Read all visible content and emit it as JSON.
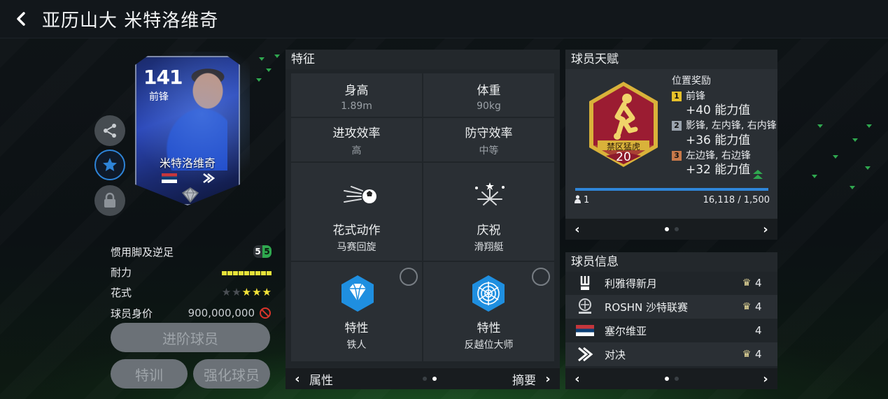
{
  "header": {
    "title": "亚历山大 米特洛维奇"
  },
  "card": {
    "rating": "141",
    "position": "前锋",
    "name": "米特洛维奇"
  },
  "left_info": {
    "weak_foot": {
      "label": "惯用脚及逆足",
      "left": "5",
      "right": "5"
    },
    "stamina": {
      "label": "耐力",
      "segments": 9
    },
    "skills": {
      "label": "花式",
      "stars": 3,
      "max": 5
    },
    "value": {
      "label": "球员身价",
      "amount": "900,000,000"
    }
  },
  "buttons": {
    "advance": "进阶球员",
    "train": "特训",
    "strengthen": "强化球员"
  },
  "traits_panel": {
    "title": "特征",
    "height": {
      "label": "身高",
      "value": "1.89m"
    },
    "weight": {
      "label": "体重",
      "value": "90kg"
    },
    "attack": {
      "label": "进攻效率",
      "value": "高"
    },
    "defense": {
      "label": "防守效率",
      "value": "中等"
    },
    "skill_move": {
      "label": "花式动作",
      "value": "马赛回旋"
    },
    "celebration": {
      "label": "庆祝",
      "value": "滑翔艇"
    },
    "trait1": {
      "label": "特性",
      "value": "铁人"
    },
    "trait2": {
      "label": "特性",
      "value": "反越位大师"
    },
    "footer_left": "属性",
    "footer_right": "摘要"
  },
  "talent_panel": {
    "title": "球员天赋",
    "badge_name": "禁区猛虎",
    "badge_level": "20",
    "bonus_title": "位置奖励",
    "bonuses": [
      {
        "rank": "1",
        "positions": "前锋",
        "value": "+40 能力值",
        "color": "#e7c12a"
      },
      {
        "rank": "2",
        "positions": "影锋, 左内锋, 右内锋",
        "value": "+36 能力值",
        "color": "#9aa3ad"
      },
      {
        "rank": "3",
        "positions": "左边锋, 右边锋",
        "value": "+32 能力值",
        "color": "#c7794a"
      }
    ],
    "count": "1",
    "progress": "16,118 / 1,500"
  },
  "info_panel": {
    "title": "球员信息",
    "rows": [
      {
        "name": "利雅得新月",
        "num": "4",
        "crown": true
      },
      {
        "name": "ROSHN 沙特联赛",
        "num": "4",
        "crown": true
      },
      {
        "name": "塞尔维亚",
        "num": "4",
        "crown": false
      },
      {
        "name": "对决",
        "num": "4",
        "crown": true
      }
    ]
  },
  "colors": {
    "accent": "#2e84d8",
    "badge_red": "#9b1c32",
    "badge_gold": "#d9b23a",
    "star": "#f3e339",
    "stamina": "#e6e23a"
  }
}
